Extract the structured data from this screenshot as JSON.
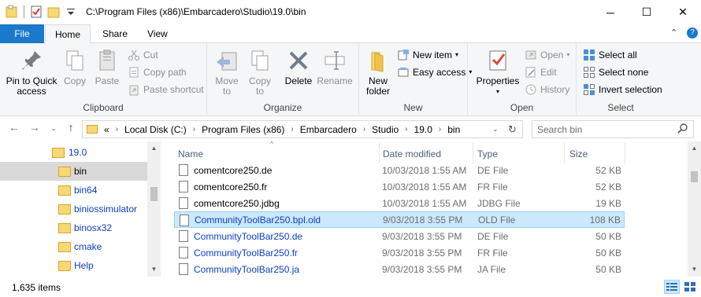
{
  "window": {
    "title": "C:\\Program Files (x86)\\Embarcadero\\Studio\\19.0\\bin",
    "minimize_glyph": "─",
    "maximize_glyph": "☐",
    "close_glyph": "✕"
  },
  "ribbon_tabs": {
    "file": "File",
    "home": "Home",
    "share": "Share",
    "view": "View",
    "collapse_glyph": "⌃",
    "help_glyph": "?"
  },
  "ribbon": {
    "clipboard": {
      "label": "Clipboard",
      "pin": "Pin to Quick access",
      "pin_line1": "Pin to Quick",
      "pin_line2": "access",
      "copy": "Copy",
      "paste": "Paste",
      "cut": "Cut",
      "copy_path": "Copy path",
      "paste_shortcut": "Paste shortcut"
    },
    "organize": {
      "label": "Organize",
      "move_to": "Move",
      "move_to_2": "to",
      "copy_to": "Copy",
      "copy_to_2": "to",
      "delete": "Delete",
      "rename": "Rename"
    },
    "new": {
      "label": "New",
      "new_folder_1": "New",
      "new_folder_2": "folder",
      "new_item": "New item",
      "easy_access": "Easy access"
    },
    "open": {
      "label": "Open",
      "properties": "Properties",
      "open": "Open",
      "edit": "Edit",
      "history": "History"
    },
    "select": {
      "label": "Select",
      "select_all": "Select all",
      "select_none": "Select none",
      "invert_selection": "Invert selection"
    }
  },
  "address_bar": {
    "overflow": "«",
    "crumbs": [
      "Local Disk (C:)",
      "Program Files (x86)",
      "Embarcadero",
      "Studio",
      "19.0",
      "bin"
    ],
    "search_placeholder": "Search bin"
  },
  "nav_pane": {
    "items": [
      {
        "label": "19.0",
        "selected": false
      },
      {
        "label": "bin",
        "selected": true
      },
      {
        "label": "bin64",
        "selected": false
      },
      {
        "label": "biniossimulator",
        "selected": false
      },
      {
        "label": "binosx32",
        "selected": false
      },
      {
        "label": "cmake",
        "selected": false
      },
      {
        "label": "Help",
        "selected": false
      }
    ]
  },
  "file_list": {
    "columns": {
      "name": "Name",
      "date_modified": "Date modified",
      "type": "Type",
      "size": "Size"
    },
    "rows": [
      {
        "name": "comentcore250.de",
        "date": "10/03/2018 1:55 AM",
        "type": "DE File",
        "size": "52 KB",
        "selected": false,
        "blue": false
      },
      {
        "name": "comentcore250.fr",
        "date": "10/03/2018 1:55 AM",
        "type": "FR File",
        "size": "52 KB",
        "selected": false,
        "blue": false
      },
      {
        "name": "comentcore250.jdbg",
        "date": "10/03/2018 1:55 AM",
        "type": "JDBG File",
        "size": "19 KB",
        "selected": false,
        "blue": false
      },
      {
        "name": "CommunityToolBar250.bpl.old",
        "date": "9/03/2018 3:55 PM",
        "type": "OLD File",
        "size": "108 KB",
        "selected": true,
        "blue": true
      },
      {
        "name": "CommunityToolBar250.de",
        "date": "9/03/2018 3:55 PM",
        "type": "DE File",
        "size": "50 KB",
        "selected": false,
        "blue": true
      },
      {
        "name": "CommunityToolBar250.fr",
        "date": "9/03/2018 3:55 PM",
        "type": "FR File",
        "size": "50 KB",
        "selected": false,
        "blue": true
      },
      {
        "name": "CommunityToolBar250.ja",
        "date": "9/03/2018 3:55 PM",
        "type": "JA File",
        "size": "50 KB",
        "selected": false,
        "blue": true
      }
    ]
  },
  "status_bar": {
    "item_count": "1,635 items"
  },
  "colors": {
    "accent": "#1979ca",
    "selection_bg": "#cce8ff",
    "selection_border": "#99d1ff",
    "link_blue": "#0b3fbf",
    "folder_yellow": "#f8d775"
  }
}
